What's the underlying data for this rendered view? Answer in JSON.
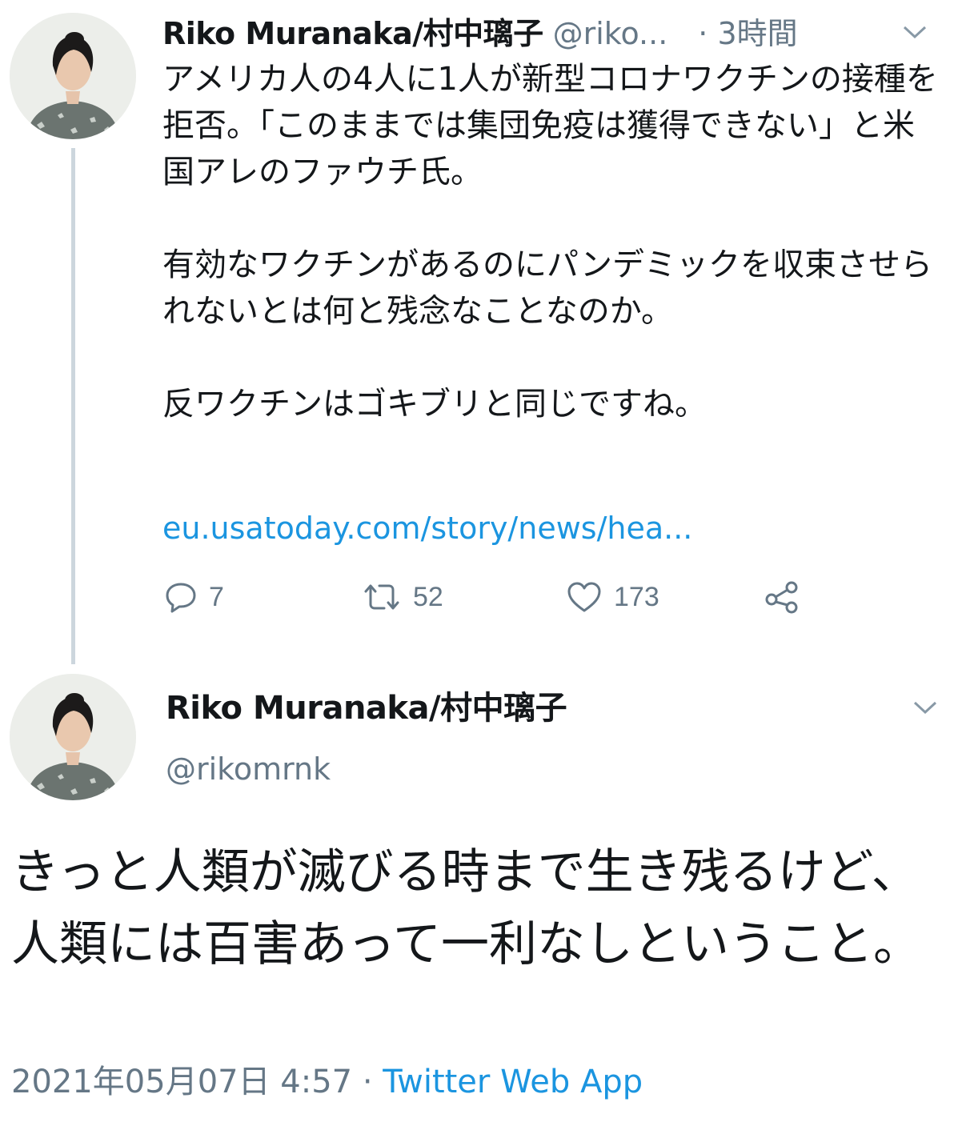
{
  "colors": {
    "text": "#14171a",
    "secondary": "#657786",
    "link": "#1b95e0",
    "thread_line": "#ccd6dd"
  },
  "icons": {
    "reply": "reply-icon",
    "retweet": "retweet-icon",
    "like": "heart-icon",
    "share": "share-icon",
    "caret": "chevron-down-icon"
  },
  "tweet1": {
    "display_name": "Riko Muranaka/村中璃子",
    "handle": "@riko...",
    "time": "· 3時間",
    "paragraphs": [
      "アメリカ人の4人に1人が新型コロナワクチンの接種を拒否。「このままでは集団免疫は獲得できない」と米国アレのファウチ氏。",
      "有効なワクチンがあるのにパンデミックを収束させられないとは何と残念なことなのか。",
      "反ワクチンはゴキブリと同じですね。"
    ],
    "link": "eu.usatoday.com/story/news/hea...",
    "replies": "7",
    "retweets": "52",
    "likes": "173"
  },
  "tweet2": {
    "display_name": "Riko Muranaka/村中璃子",
    "handle": "@rikomrnk",
    "text": "きっと人類が滅びる時まで生き残るけど、人類には百害あって一利なしということ。",
    "timestamp": "2021年05月07日 4:57",
    "separator": " · ",
    "source": "Twitter Web App"
  }
}
